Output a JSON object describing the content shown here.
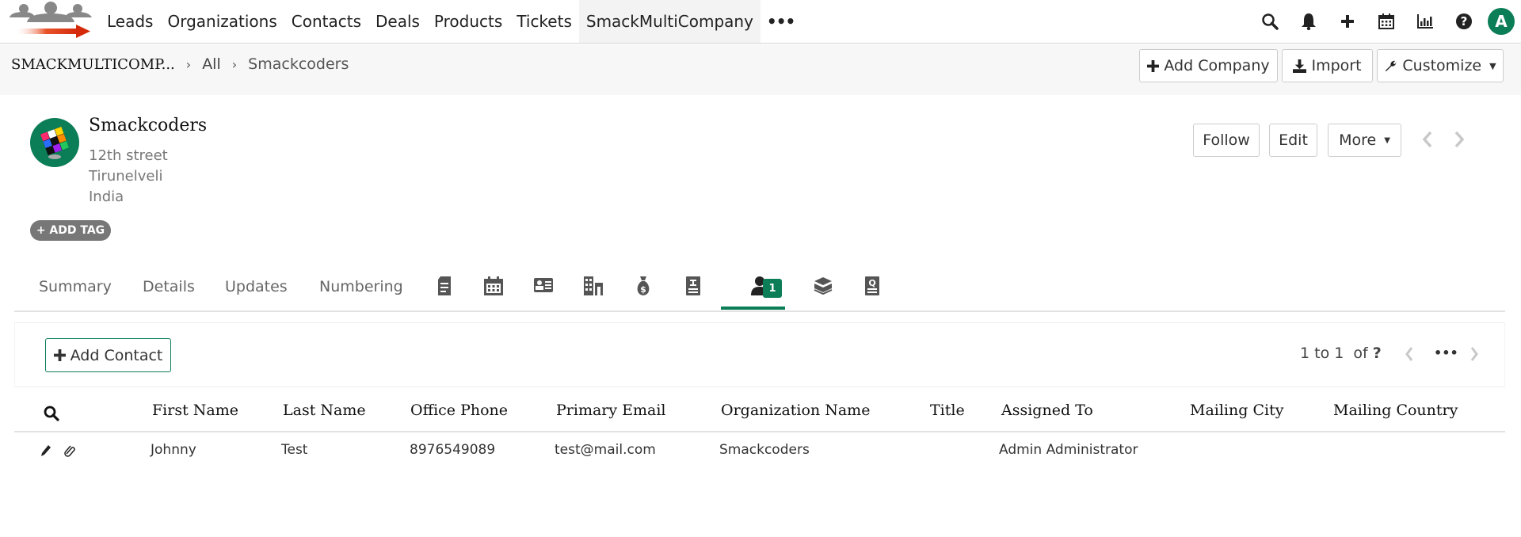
{
  "topnav": {
    "items": [
      "Leads",
      "Organizations",
      "Contacts",
      "Deals",
      "Products",
      "Tickets",
      "SmackMultiCompany"
    ],
    "active_item": "SmackMultiCompany",
    "more_label": "•••",
    "icons": [
      "search-icon",
      "bell-icon",
      "plus-icon",
      "calendar-icon",
      "chart-icon",
      "help-icon"
    ],
    "user_initial": "A"
  },
  "breadcrumb": {
    "module": "SMACKMULTICOMP...",
    "filter": "All",
    "record": "Smackcoders",
    "separator": "›"
  },
  "toolbar": {
    "add_company_label": "Add Company",
    "import_label": "Import",
    "customize_label": "Customize"
  },
  "record": {
    "name": "Smackcoders",
    "address": [
      "12th street",
      "Tirunelveli",
      "India"
    ],
    "add_tag_label": "+ ADD TAG",
    "follow_label": "Follow",
    "edit_label": "Edit",
    "more_label": "More"
  },
  "tabs": {
    "text_tabs": [
      "Summary",
      "Details",
      "Updates",
      "Numbering"
    ],
    "icon_tabs": [
      "document-icon",
      "calendar-icon",
      "contact-card-icon",
      "building-icon",
      "money-bag-icon",
      "invoice-icon",
      "contacts-icon",
      "box-icon",
      "quote-icon"
    ],
    "active_tab": "contacts-icon",
    "contacts_count": "1"
  },
  "related_list": {
    "add_contact_label": "Add Contact",
    "pager": {
      "range": "1 to 1",
      "of_label": "of",
      "total": "?"
    },
    "columns": [
      "First Name",
      "Last Name",
      "Office Phone",
      "Primary Email",
      "Organization Name",
      "Title",
      "Assigned To",
      "Mailing City",
      "Mailing Country"
    ],
    "rows": [
      [
        "Johnny",
        "Test",
        "8976549089",
        "test@mail.com",
        "Smackcoders",
        "",
        "Admin Administrator",
        "",
        ""
      ]
    ]
  },
  "colors": {
    "accent": "#0b7d57",
    "tag_bg": "#777777",
    "crumb_bar_bg": "#f7f7f7"
  }
}
